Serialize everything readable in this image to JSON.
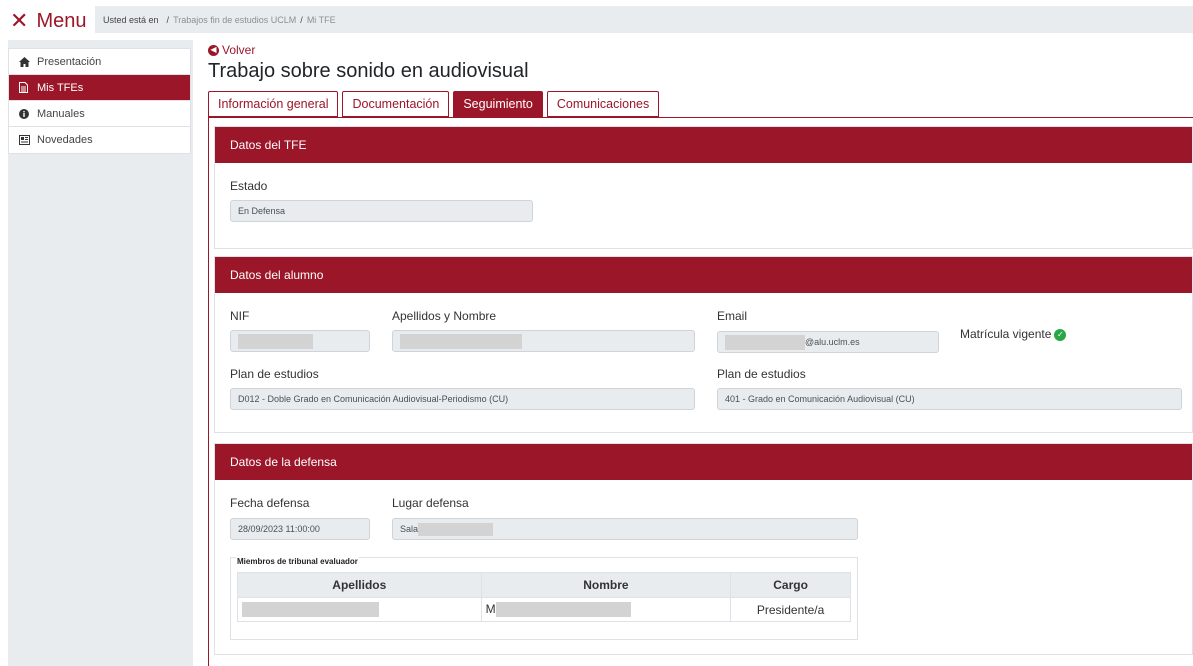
{
  "topbar": {
    "menu_icon": "close-icon",
    "menu_label": "Menu",
    "breadcrumb": {
      "lead": "Usted está en",
      "separator": "/",
      "items": [
        "Trabajos fin de estudios UCLM",
        "Mi TFE"
      ]
    }
  },
  "sidebar": {
    "items": [
      {
        "label": "Presentación",
        "icon": "home-icon",
        "active": false
      },
      {
        "label": "Mis TFEs",
        "icon": "file-icon",
        "active": true
      },
      {
        "label": "Manuales",
        "icon": "info-icon",
        "active": false
      },
      {
        "label": "Novedades",
        "icon": "newspaper-icon",
        "active": false
      }
    ]
  },
  "main": {
    "back_label": "Volver",
    "title": "Trabajo sobre sonido en audiovisual",
    "tabs": [
      {
        "label": "Información general",
        "active": false
      },
      {
        "label": "Documentación",
        "active": false
      },
      {
        "label": "Seguimiento",
        "active": true
      },
      {
        "label": "Comunicaciones",
        "active": false
      }
    ]
  },
  "datos_tfe": {
    "header": "Datos del TFE",
    "estado_label": "Estado",
    "estado_value": "En Defensa"
  },
  "datos_alumno": {
    "header": "Datos del alumno",
    "nif_label": "NIF",
    "apellidos_label": "Apellidos y Nombre",
    "email_label": "Email",
    "email_value": "@alu.uclm.es",
    "matricula_label": "Matrícula vigente",
    "plan1_label": "Plan de estudios",
    "plan1_value": "D012 - Doble Grado en Comunicación Audiovisual-Periodismo (CU)",
    "plan2_label": "Plan de estudios",
    "plan2_value": "401 - Grado en Comunicación Audiovisual (CU)"
  },
  "datos_defensa": {
    "header": "Datos de la defensa",
    "fecha_label": "Fecha defensa",
    "fecha_value": "28/09/2023 11:00:00",
    "lugar_label": "Lugar defensa",
    "lugar_value": "Sala",
    "tribunal_legend": "Miembros de tribunal evaluador",
    "columns": [
      "Apellidos",
      "Nombre",
      "Cargo"
    ],
    "rows": [
      {
        "apellidos": "",
        "nombre": "M",
        "cargo": "Presidente/a"
      }
    ]
  },
  "colors": {
    "brand": "#9b1628",
    "success": "#28a745",
    "field_bg": "#e9ecef"
  }
}
